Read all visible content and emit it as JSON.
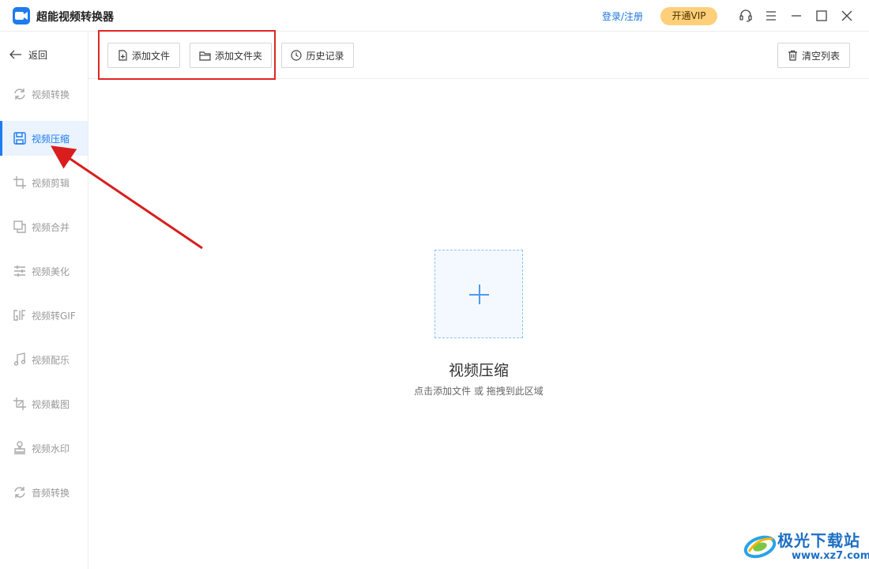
{
  "window": {
    "title": "超能视频转换器",
    "login_label": "登录/注册",
    "vip_label": "开通VIP"
  },
  "sidebar": {
    "back_label": "返回",
    "items": [
      {
        "label": "视频转换",
        "icon": "refresh-icon"
      },
      {
        "label": "视频压缩",
        "icon": "compress-icon",
        "active": true
      },
      {
        "label": "视频剪辑",
        "icon": "crop-icon"
      },
      {
        "label": "视频合并",
        "icon": "merge-icon"
      },
      {
        "label": "视频美化",
        "icon": "sliders-icon"
      },
      {
        "label": "视频转GIF",
        "icon": "gif-icon"
      },
      {
        "label": "视频配乐",
        "icon": "music-icon"
      },
      {
        "label": "视频截图",
        "icon": "screenshot-crop-icon"
      },
      {
        "label": "视频水印",
        "icon": "stamp-icon"
      },
      {
        "label": "音频转换",
        "icon": "refresh-icon"
      }
    ]
  },
  "toolbar": {
    "add_file_label": "添加文件",
    "add_folder_label": "添加文件夹",
    "history_label": "历史记录",
    "clear_list_label": "清空列表"
  },
  "main": {
    "empty_title": "视频压缩",
    "empty_hint": "点击添加文件 或 拖拽到此区域"
  },
  "watermark": {
    "text": "极光下载站",
    "url": "www.xz7.com"
  },
  "colors": {
    "accent": "#1e7bf0",
    "vip": "#ffcf7a",
    "annotation": "#e32424"
  }
}
